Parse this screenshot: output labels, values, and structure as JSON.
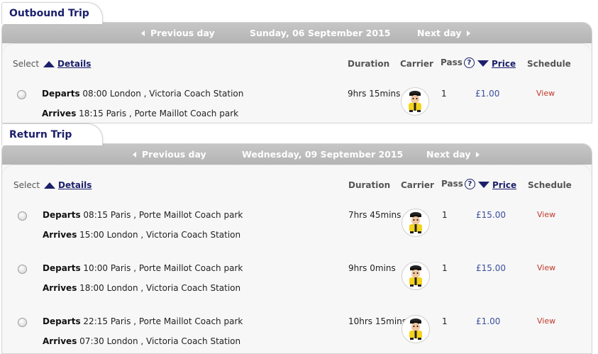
{
  "outbound": {
    "tab": "Outbound Trip",
    "nav": {
      "prev": "Previous day",
      "date": "Sunday, 06 September 2015",
      "next": "Next day"
    },
    "headers": {
      "select": "Select",
      "details": "Details",
      "duration": "Duration",
      "carrier": "Carrier",
      "pass": "Pass",
      "price": "Price",
      "schedule": "Schedule"
    },
    "rows": [
      {
        "departs_label": "Departs",
        "departs": "08:00 London , Victoria Coach Station",
        "arrives_label": "Arrives",
        "arrives": "18:15 Paris , Porte Maillot Coach park",
        "duration": "9hrs 15mins",
        "pass": "1",
        "price": "£1.00",
        "schedule": "View"
      }
    ]
  },
  "return": {
    "tab": "Return Trip",
    "nav": {
      "prev": "Previous day",
      "date": "Wednesday, 09 September 2015",
      "next": "Next day"
    },
    "headers": {
      "select": "Select",
      "details": "Details",
      "duration": "Duration",
      "carrier": "Carrier",
      "pass": "Pass",
      "price": "Price",
      "schedule": "Schedule"
    },
    "rows": [
      {
        "departs_label": "Departs",
        "departs": "08:15 Paris , Porte Maillot Coach park",
        "arrives_label": "Arrives",
        "arrives": "15:00 London , Victoria Coach Station",
        "duration": "7hrs 45mins",
        "pass": "1",
        "price": "£15.00",
        "schedule": "View"
      },
      {
        "departs_label": "Departs",
        "departs": "10:00 Paris , Porte Maillot Coach park",
        "arrives_label": "Arrives",
        "arrives": "18:00 London , Victoria Coach Station",
        "duration": "9hrs 0mins",
        "pass": "1",
        "price": "£15.00",
        "schedule": "View"
      },
      {
        "departs_label": "Departs",
        "departs": "22:15 Paris , Porte Maillot Coach park",
        "arrives_label": "Arrives",
        "arrives": "07:30 London , Victoria Coach Station",
        "duration": "10hrs 15mins",
        "pass": "1",
        "price": "£1.00",
        "schedule": "View"
      }
    ]
  },
  "icons": {
    "carrier": "coach-driver-mascot-icon",
    "help": "question-circle-icon",
    "sort_up": "triangle-up-icon",
    "sort_down": "triangle-down-icon",
    "prev": "triangle-left-icon",
    "next": "triangle-right-icon"
  },
  "colors": {
    "accent": "#1b1f6b",
    "price": "#3d4f9c",
    "view_link": "#c0392b",
    "navbar": "#bbbbbb"
  }
}
